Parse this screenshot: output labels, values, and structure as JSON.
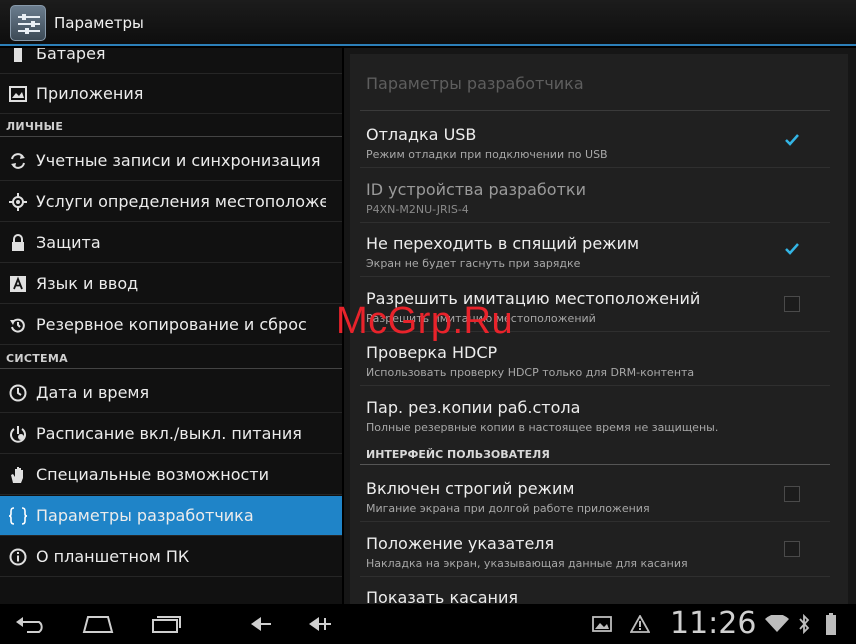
{
  "actionbar": {
    "title": "Параметры",
    "icon": "settings-icon"
  },
  "left": {
    "items_top": [
      {
        "label": "Батарея",
        "icon": "battery-icon"
      },
      {
        "label": "Приложения",
        "icon": "apps-icon"
      }
    ],
    "section_personal": "ЛИЧНЫЕ",
    "items_personal": [
      {
        "label": "Учетные записи и синхронизация",
        "icon": "sync-icon"
      },
      {
        "label": "Услуги определения местоположения",
        "icon": "location-icon"
      },
      {
        "label": "Защита",
        "icon": "lock-icon"
      },
      {
        "label": "Язык и ввод",
        "icon": "keyboard-icon"
      },
      {
        "label": "Резервное копирование и сброс",
        "icon": "backup-icon"
      }
    ],
    "section_system": "СИСТЕМА",
    "items_system": [
      {
        "label": "Дата и время",
        "icon": "clock-icon"
      },
      {
        "label": "Расписание вкл./выкл. питания",
        "icon": "power-schedule-icon"
      },
      {
        "label": "Специальные возможности",
        "icon": "hand-icon"
      },
      {
        "label": "Параметры разработчика",
        "icon": "braces-icon",
        "active": true
      },
      {
        "label": "О планшетном ПК",
        "icon": "info-icon"
      }
    ]
  },
  "right": {
    "heading": "Параметры разработчика",
    "prefs": [
      {
        "title": "Отладка USB",
        "summary": "Режим отладки при подключении по USB",
        "checked": true
      },
      {
        "title": "ID устройства разработки",
        "summary": "P4XN-M2NU-JRIS-4",
        "disabled": true
      },
      {
        "title": "Не переходить в спящий режим",
        "summary": "Экран не будет гаснуть при зарядке",
        "checked": true
      },
      {
        "title": "Разрешить имитацию местоположений",
        "summary": "Разрешить имитацию местоположений",
        "checked": false
      },
      {
        "title": "Проверка HDCP",
        "summary": "Использовать проверку HDCP только для DRM-контента"
      },
      {
        "title": "Пар. рез.копии раб.стола",
        "summary": "Полные резервные копии в настоящее время не защищены."
      }
    ],
    "subsection": "ИНТЕРФЕЙС ПОЛЬЗОВАТЕЛЯ",
    "prefs_ui": [
      {
        "title": "Включен строгий режим",
        "summary": "Мигание экрана при долгой работе приложения",
        "checked": false
      },
      {
        "title": "Положение указателя",
        "summary": "Накладка на экран, указывающая данные для касания",
        "checked": false
      },
      {
        "title": "Показать касания",
        "summary": ""
      }
    ]
  },
  "watermark": "McGrp.Ru",
  "sysbar": {
    "time": "11:26",
    "buttons": [
      "back-icon",
      "home-icon",
      "recent-apps-icon",
      "volume-down-icon",
      "volume-up-icon"
    ],
    "status_icons": [
      "gallery-notification-icon",
      "warning-icon",
      "wifi-icon",
      "bluetooth-icon",
      "battery-status-icon"
    ]
  },
  "colors": {
    "accent": "#1f84c8",
    "watermark": "#e8232b"
  }
}
